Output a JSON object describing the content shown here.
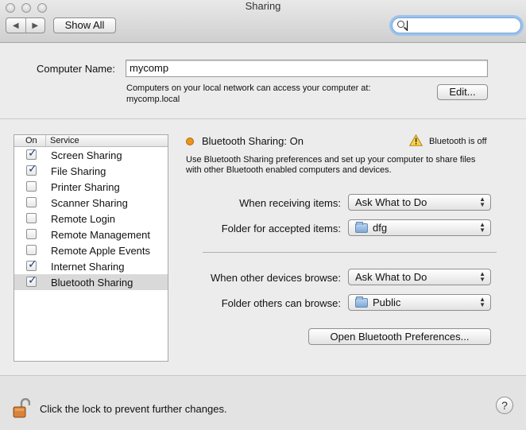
{
  "window": {
    "title": "Sharing"
  },
  "toolbar": {
    "back_icon": "◀",
    "forward_icon": "▶",
    "show_all_label": "Show All",
    "search_value": "",
    "search_icon": "search-icon"
  },
  "computer_name": {
    "label": "Computer Name:",
    "value": "mycomp",
    "info_line1": "Computers on your local network can access your computer at:",
    "info_line2": "mycomp.local",
    "edit_label": "Edit..."
  },
  "services": {
    "header_on": "On",
    "header_service": "Service",
    "items": [
      {
        "label": "Screen Sharing",
        "checked": true
      },
      {
        "label": "File Sharing",
        "checked": true
      },
      {
        "label": "Printer Sharing",
        "checked": false
      },
      {
        "label": "Scanner Sharing",
        "checked": false
      },
      {
        "label": "Remote Login",
        "checked": false
      },
      {
        "label": "Remote Management",
        "checked": false
      },
      {
        "label": "Remote Apple Events",
        "checked": false
      },
      {
        "label": "Internet Sharing",
        "checked": true
      },
      {
        "label": "Bluetooth Sharing",
        "checked": true,
        "selected": true
      }
    ]
  },
  "detail": {
    "status_title": "Bluetooth Sharing: On",
    "status_color": "#e8951c",
    "warning_text": "Bluetooth is off",
    "description_line1": "Use Bluetooth Sharing preferences and set up your computer to share files",
    "description_line2": "with other Bluetooth enabled computers and devices.",
    "receiving_label": "When receiving items:",
    "receiving_value": "Ask What to Do",
    "accepted_folder_label": "Folder for accepted items:",
    "accepted_folder_value": "dfg",
    "browse_label": "When other devices browse:",
    "browse_value": "Ask What to Do",
    "browse_folder_label": "Folder others can browse:",
    "browse_folder_value": "Public",
    "open_prefs_label": "Open Bluetooth Preferences..."
  },
  "footer": {
    "lock_text": "Click the lock to prevent further changes.",
    "help_label": "?"
  }
}
